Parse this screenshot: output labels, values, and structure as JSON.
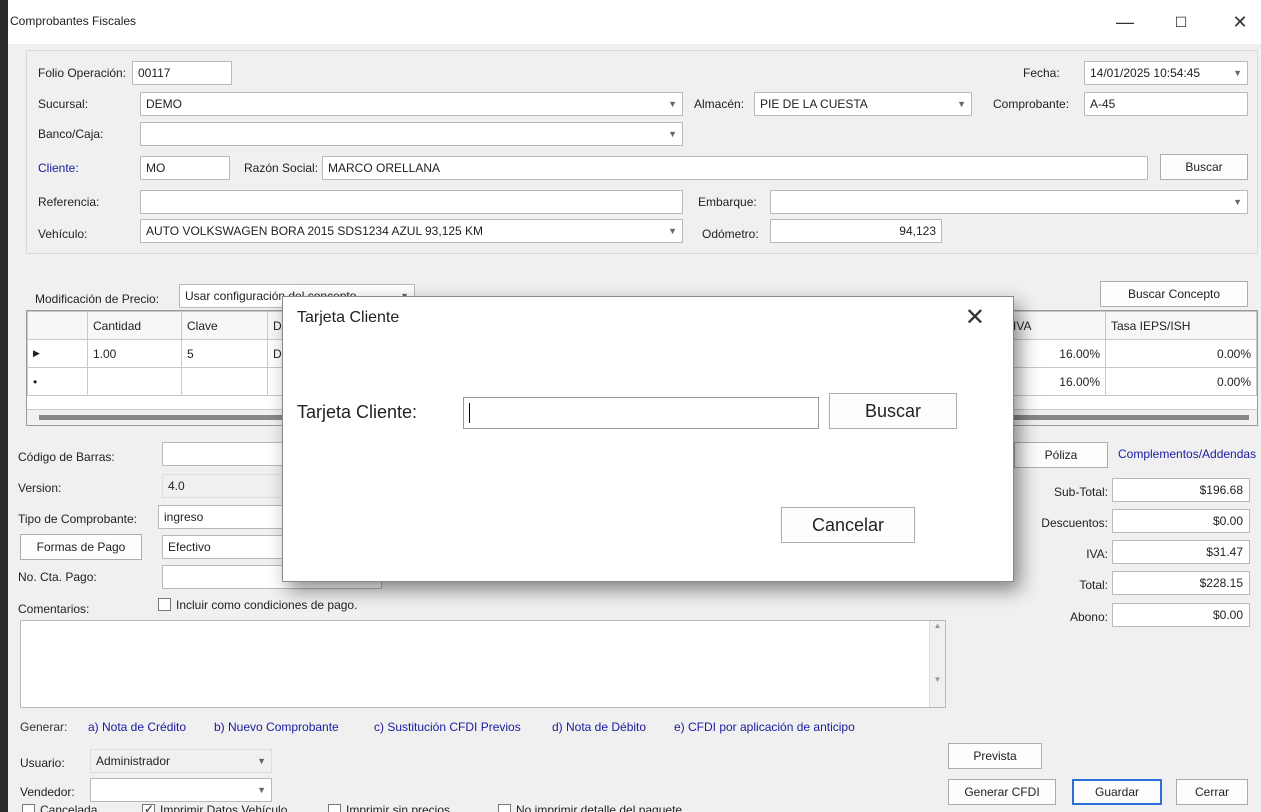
{
  "window": {
    "title": "Comprobantes Fiscales",
    "min": "—",
    "max": "☐",
    "close": "✕"
  },
  "header": {
    "folio_label": "Folio Operación:",
    "folio_value": "00117",
    "fecha_label": "Fecha:",
    "fecha_value": "14/01/2025 10:54:45",
    "sucursal_label": "Sucursal:",
    "sucursal_value": "DEMO",
    "almacen_label": "Almacén:",
    "almacen_value": "PIE DE LA CUESTA",
    "comprobante_label": "Comprobante:",
    "comprobante_value": "A-45",
    "banco_label": "Banco/Caja:",
    "banco_value": "",
    "cliente_label": "Cliente:",
    "cliente_value": "MO",
    "razon_label": "Razón Social:",
    "razon_value": "MARCO ORELLANA",
    "buscar_label": "Buscar",
    "referencia_label": "Referencia:",
    "referencia_value": "",
    "embarque_label": "Embarque:",
    "embarque_value": "",
    "vehiculo_label": "Vehículo:",
    "vehiculo_value": "AUTO VOLKSWAGEN BORA 2015 SDS1234 AZUL 93,125 KM",
    "odometro_label": "Odómetro:",
    "odometro_value": "94,123"
  },
  "pricing": {
    "mod_label": "Modificación de Precio:",
    "mod_value": "Usar configuración del concepto",
    "buscar_concepto": "Buscar Concepto"
  },
  "grid": {
    "headers": {
      "cantidad": "Cantidad",
      "clave": "Clave",
      "d": "D",
      "iva": "IVA",
      "ieps": "Tasa IEPS/ISH"
    },
    "rows": [
      {
        "marker": "▶",
        "cantidad": "1.00",
        "clave": "5",
        "d": "D",
        "iva": "16.00%",
        "ieps": "0.00%"
      },
      {
        "marker": "•",
        "cantidad": "",
        "clave": "",
        "d": "",
        "iva": "16.00%",
        "ieps": "0.00%"
      }
    ]
  },
  "details": {
    "barras_label": "Código de Barras:",
    "version_label": "Version:",
    "version_value": "4.0",
    "tipo_label": "Tipo de Comprobante:",
    "tipo_value": "ingreso",
    "formas_label": "Formas de Pago",
    "formas_value": "Efectivo",
    "cta_label": "No. Cta. Pago:",
    "comentarios_label": "Comentarios:",
    "incluir_label": "Incluir como condiciones de pago.",
    "poliza_label": "Póliza",
    "complementos_label": "Complementos/Addendas"
  },
  "totals": {
    "subtotal_label": "Sub-Total:",
    "subtotal": "$196.68",
    "descuentos_label": "Descuentos:",
    "descuentos": "$0.00",
    "iva_label": "IVA:",
    "iva": "$31.47",
    "total_label": "Total:",
    "total": "$228.15",
    "abono_label": "Abono:",
    "abono": "$0.00"
  },
  "generar": {
    "label": "Generar:",
    "a": "a) Nota de Crédito",
    "b": "b) Nuevo Comprobante",
    "c": "c) Sustitución CFDI Previos",
    "d": "d) Nota de Débito",
    "e": "e) CFDI por aplicación de anticipo"
  },
  "footer": {
    "usuario_label": "Usuario:",
    "usuario_value": "Administrador",
    "vendedor_label": "Vendedor:",
    "vendedor_value": "",
    "prevista": "Prevista",
    "generar_cfdi": "Generar CFDI",
    "guardar": "Guardar",
    "cerrar": "Cerrar",
    "cancelada": "Cancelada",
    "imprimir_datos": "Imprimir Datos Vehículo",
    "imprimir_sin": "Imprimir sin precios",
    "no_imprimir": "No imprimir detalle del paquete"
  },
  "modal": {
    "title": "Tarjeta Cliente",
    "close": "✕",
    "field_label": "Tarjeta Cliente:",
    "field_value": "",
    "buscar": "Buscar",
    "cancelar": "Cancelar"
  }
}
